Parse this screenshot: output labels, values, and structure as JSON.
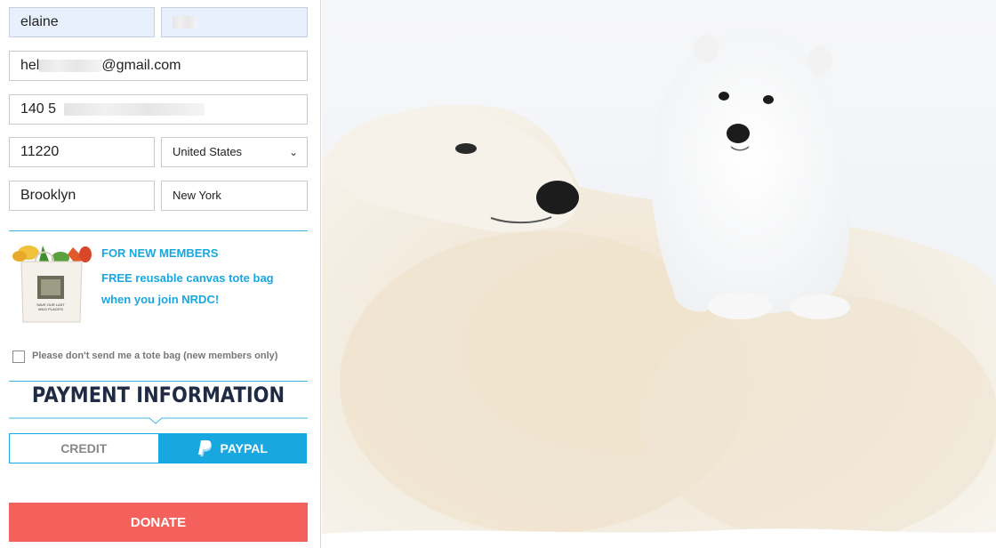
{
  "form": {
    "first_name": "elaine",
    "email_prefix": "hel",
    "email_suffix": "@gmail.com",
    "phone_prefix": "140 5",
    "zip": "11220",
    "country": "United States",
    "city": "Brooklyn",
    "state": "New York"
  },
  "promo": {
    "heading": "FOR NEW MEMBERS",
    "line1": "FREE reusable canvas tote bag",
    "line2": "when you join NRDC!",
    "bag_text": "SAVE OUR LAST WILD PLACES!"
  },
  "opt_out": {
    "label": "Please don't send me a tote bag (new members only)",
    "checked": false
  },
  "payment": {
    "title": "PAYMENT INFORMATION",
    "tabs": [
      {
        "label": "CREDIT",
        "active": false
      },
      {
        "label": "PAYPAL",
        "active": true,
        "icon": "paypal-icon"
      }
    ]
  },
  "donate_label": "DONATE",
  "colors": {
    "accent": "#19a7e0",
    "donate": "#f4605b",
    "title": "#1f2a44",
    "autofill": "#e8f0fe"
  }
}
